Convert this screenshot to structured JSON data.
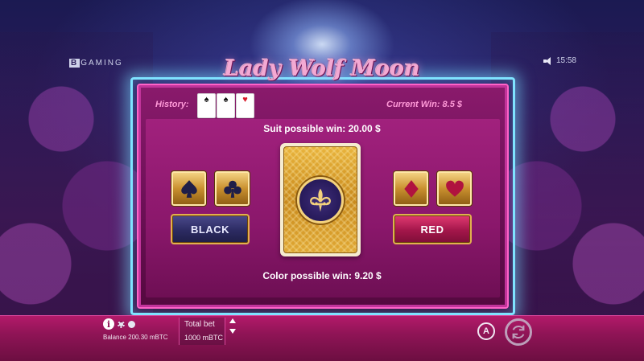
{
  "brand": {
    "prefix": "B",
    "rest": "GAMING"
  },
  "time": "15:58",
  "logo": "Lady Wolf Moon",
  "history": {
    "label": "History:",
    "cards": [
      {
        "suit": "♠",
        "color": "black"
      },
      {
        "suit": "♠",
        "color": "black"
      },
      {
        "suit": "♥",
        "color": "red"
      }
    ]
  },
  "current_win": "Current Win: 8.5 $",
  "suit_win": "Suit possible win: 20.00 $",
  "color_win": "Color possible win: 9.20 $",
  "buttons": {
    "black": "BLACK",
    "red": "RED"
  },
  "suit_buttons": [
    "spade-icon",
    "club-icon",
    "diamond-icon",
    "heart-icon"
  ],
  "bottom": {
    "info": "i",
    "balance": "Balance 200.30 mBTC",
    "total_bet_label": "Total bet",
    "total_bet_value": "1000 mBTC",
    "auto_label": "A"
  },
  "colors": {
    "panel": "#8a1a6c",
    "glow": "#7fe3ff",
    "gold": "#c9902f",
    "logo": "#f3a9d3"
  }
}
